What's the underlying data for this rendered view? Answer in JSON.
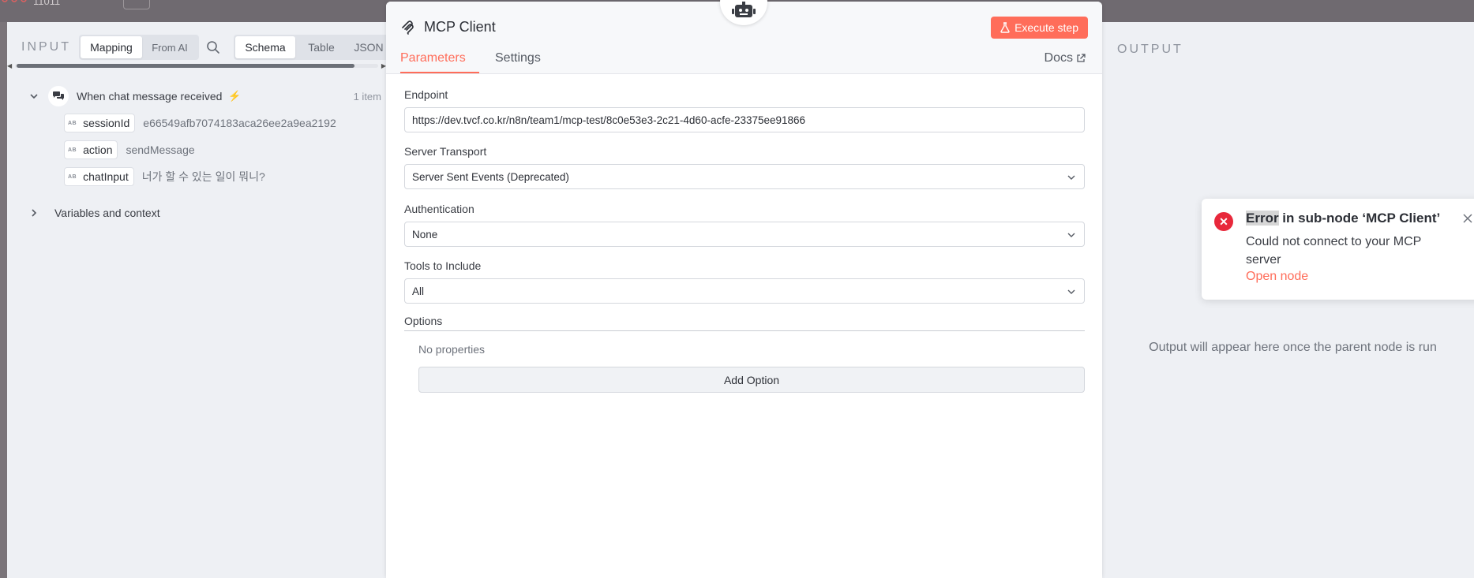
{
  "canvas": {
    "corner_text": "11011"
  },
  "input_panel": {
    "title": "INPUT",
    "mode_tabs": [
      "Mapping",
      "From AI"
    ],
    "view_tabs": [
      "Schema",
      "Table",
      "JSON"
    ],
    "trigger": {
      "label": "When chat message received",
      "count": "1 item"
    },
    "fields": [
      {
        "type": "AB",
        "name": "sessionId",
        "value": "e66549afb7074183aca26ee2a9ea2192"
      },
      {
        "type": "AB",
        "name": "action",
        "value": "sendMessage"
      },
      {
        "type": "AB",
        "name": "chatInput",
        "value": "너가 할 수 있는 일이 뭐니?"
      }
    ],
    "variables_label": "Variables and context"
  },
  "node": {
    "title": "MCP Client",
    "execute_label": "Execute step",
    "tabs": [
      "Parameters",
      "Settings"
    ],
    "docs_label": "Docs",
    "endpoint_label": "Endpoint",
    "endpoint_value": "https://dev.tvcf.co.kr/n8n/team1/mcp-test/8c0e53e3-2c21-4d60-acfe-23375ee91866",
    "transport_label": "Server Transport",
    "transport_value": "Server Sent Events (Deprecated)",
    "auth_label": "Authentication",
    "auth_value": "None",
    "tools_label": "Tools to Include",
    "tools_value": "All",
    "options_label": "Options",
    "no_properties": "No properties",
    "add_option_label": "Add Option"
  },
  "output_panel": {
    "title": "OUTPUT",
    "message": "Output will appear here once the parent node is run"
  },
  "toast": {
    "title_highlight": "Error",
    "title_rest": " in sub-node ‘MCP Client’",
    "message": "Could not connect to your MCP server",
    "link": "Open node"
  },
  "colors": {
    "accent": "#ff6d5a",
    "error": "#e8283b",
    "panel_bg": "#eef0f4"
  }
}
